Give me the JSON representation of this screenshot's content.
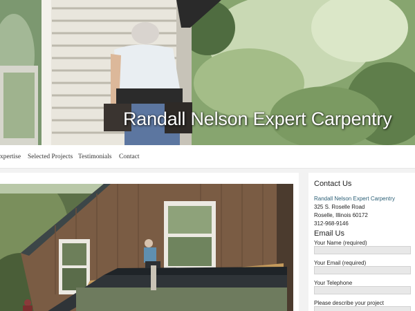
{
  "hero": {
    "title": "Randall Nelson Expert Carpentry"
  },
  "nav": {
    "items": [
      "xpertise",
      "Selected Projects",
      "Testimonials",
      "Contact"
    ]
  },
  "sidebar": {
    "contact_heading": "Contact Us",
    "company_link": "Randall Nelson Expert Carpentry",
    "address_line1": "325 S. Roselle Road",
    "address_line2": "Roselle, Illinois 60172",
    "phone": "312-968-9146",
    "email_heading": "Email Us",
    "fields": [
      {
        "label": "Your Name (required)",
        "value": ""
      },
      {
        "label": "Your Email (required)",
        "value": ""
      },
      {
        "label": "Your Telephone",
        "value": ""
      },
      {
        "label": "Please describe your project",
        "value": ""
      }
    ]
  },
  "colors": {
    "link": "#2b5f76",
    "sidebar_bg": "#ffffff",
    "page_bg": "#f2f2f2",
    "input_bg": "#e8e8e8"
  }
}
